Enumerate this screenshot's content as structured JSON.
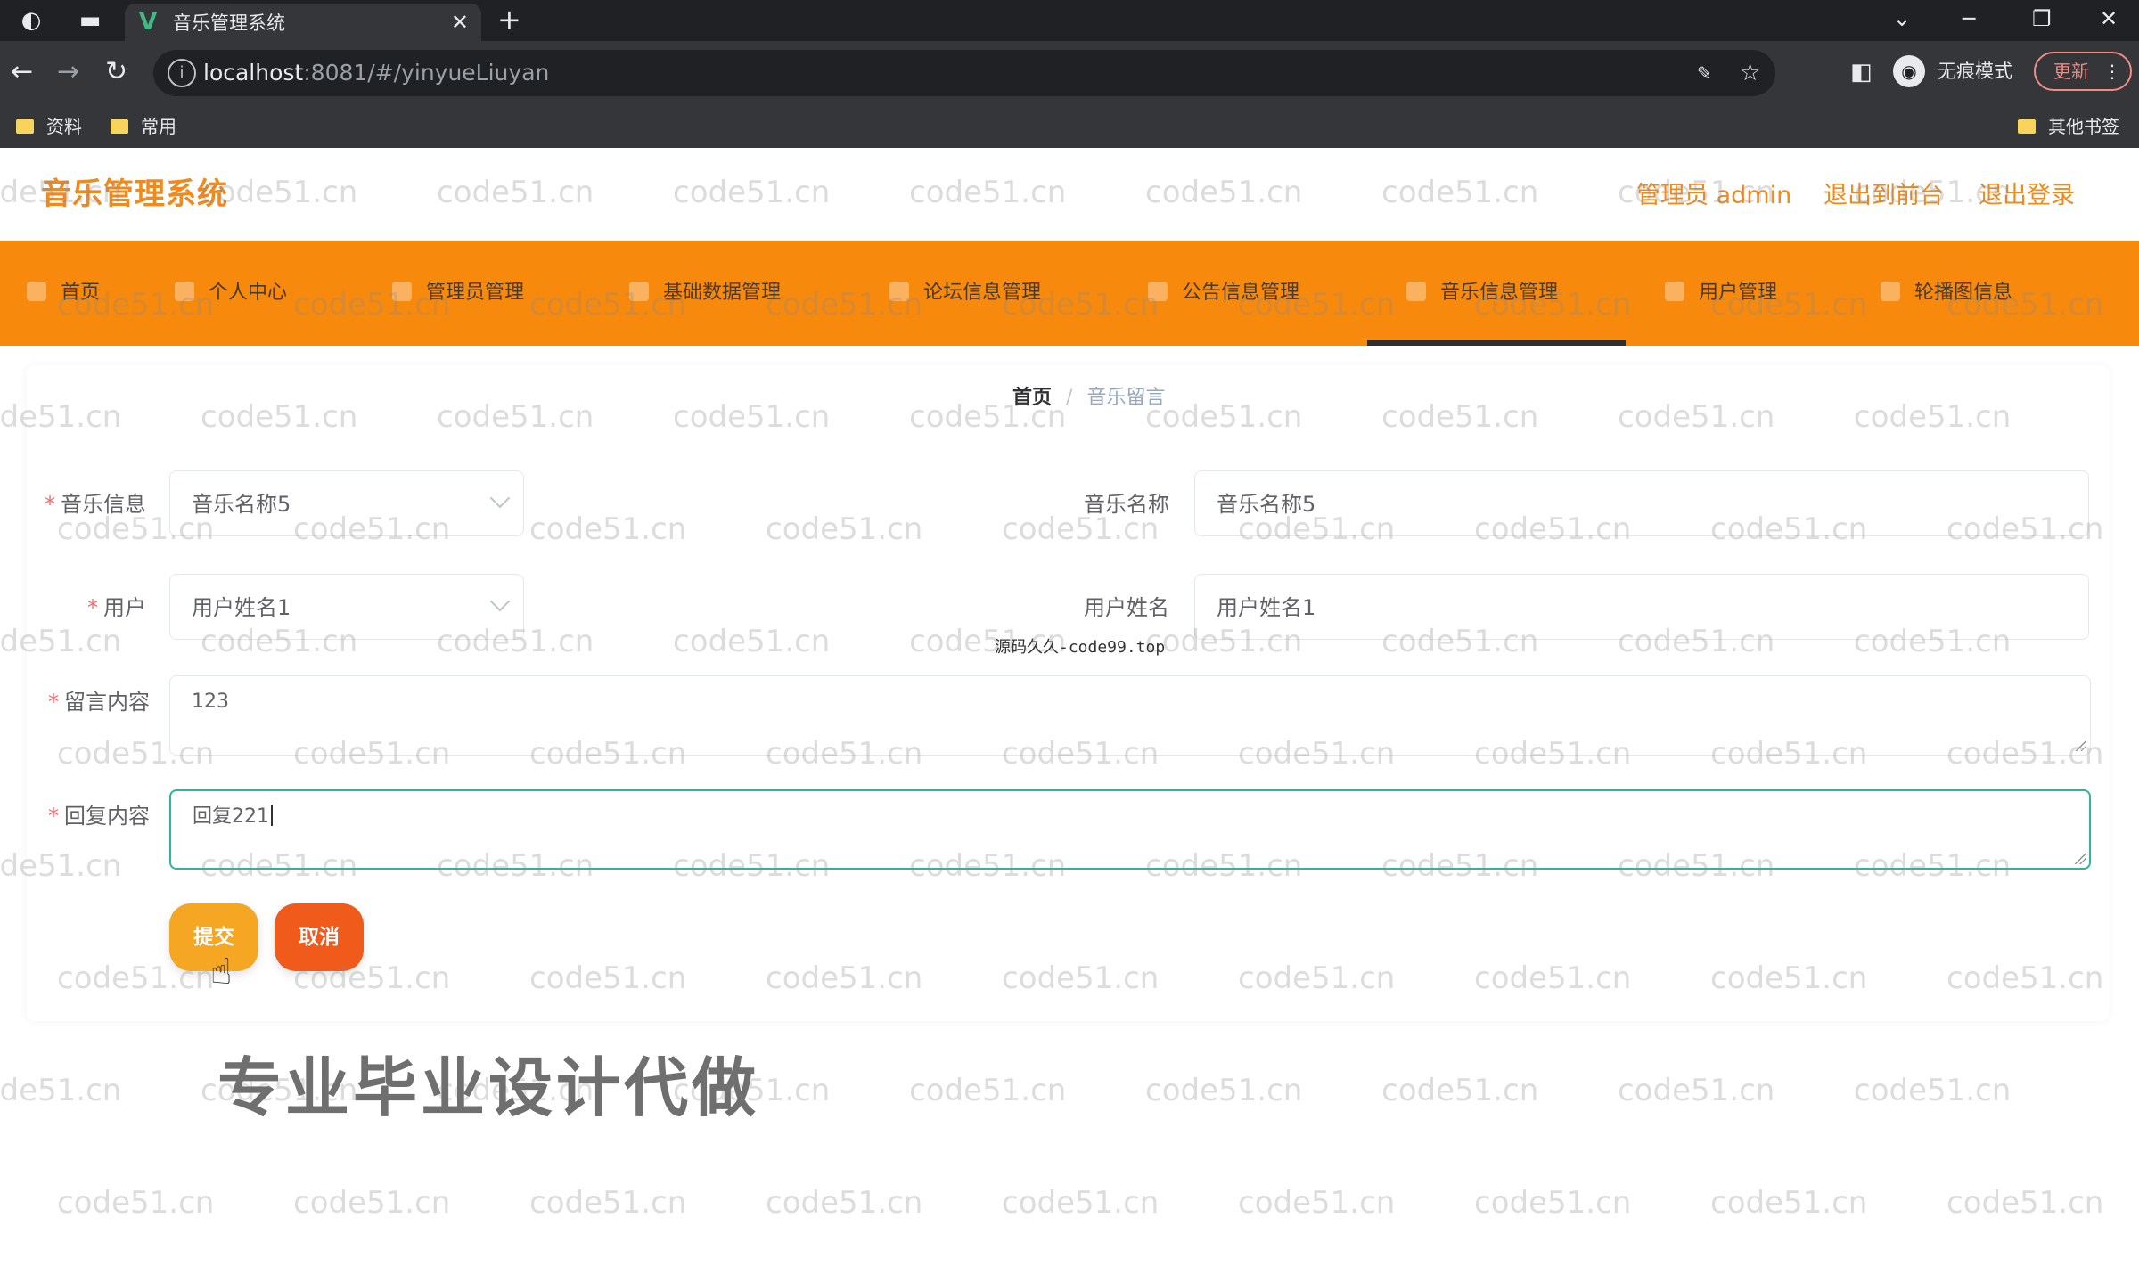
{
  "browser": {
    "tab_title": "音乐管理系统",
    "tab_favicon": "V",
    "url_host": "localhost",
    "url_path": ":8081/#/yinyueLiuyan",
    "profile_label": "无痕模式",
    "update_label": "更新",
    "bookmarks": [
      "资料",
      "常用"
    ],
    "bookmarks_other": "其他书签"
  },
  "app": {
    "title": "音乐管理系统",
    "admin_label": "管理员 admin",
    "back_to_admin": "退出到前台",
    "logout": "退出登录"
  },
  "nav": {
    "items": [
      "首页",
      "个人中心",
      "管理员管理",
      "基础数据管理",
      "论坛信息管理",
      "公告信息管理",
      "音乐信息管理",
      "用户管理",
      "轮播图信息"
    ],
    "active_index": 6
  },
  "breadcrumb": {
    "home": "首页",
    "separator": "/",
    "current": "音乐留言"
  },
  "form": {
    "music_info_label": "音乐信息",
    "music_info_value": "音乐名称5",
    "music_name_label": "音乐名称",
    "music_name_value": "音乐名称5",
    "user_label": "用户",
    "user_value": "用户姓名1",
    "user_name_label": "用户姓名",
    "user_name_value": "用户姓名1",
    "message_label": "留言内容",
    "message_value": "123",
    "reply_label": "回复内容",
    "reply_value": "回复221",
    "submit_label": "提交",
    "cancel_label": "取消"
  },
  "overlay": {
    "watermark_text": "code51.cn",
    "center_watermark": "源码久久-code99.top",
    "promo_text": "专业毕业设计代做"
  },
  "colors": {
    "accent": "#f7890c",
    "title_orange": "#f08a1c",
    "submit": "#f5a623",
    "cancel": "#f05a1a",
    "focus": "#2fb59a"
  }
}
